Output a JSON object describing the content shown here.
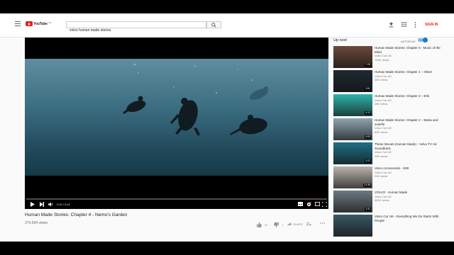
{
  "masthead": {
    "logo_text": "YouTube",
    "logo_region": "GB",
    "search_value": "volvo human made stories",
    "signin_label": "SIGN IN",
    "icons": [
      "menu-icon",
      "search-icon",
      "upload-icon",
      "apps-icon",
      "more-vert-icon"
    ]
  },
  "player": {
    "time_current": "0:00",
    "time_total": "5:41",
    "progress_fraction": 0.0
  },
  "video": {
    "title": "Human Made Stories: Chapter 4 - Nemo's Garden",
    "views": "274,934 views",
    "likes": "42",
    "dislikes": "1",
    "share_label": "SHARE"
  },
  "sidebar": {
    "up_next_label": "Up next",
    "autoplay_label": "AUTOPLAY",
    "autoplay_on": true,
    "items": [
      {
        "title": "Human Made Stories: Chapter 5 - Music of the Mind",
        "channel": "Volvo Car UK",
        "views": "754K views",
        "duration": "7:25",
        "color": "#6b4a3a"
      },
      {
        "title": "Human Made Stories: Chapter 1 – Oliver",
        "channel": "Volvo Car UK",
        "views": "45K views",
        "duration": "3:51",
        "color": "#1e2a33"
      },
      {
        "title": "Human Made Stories: Chapter 3 – Erik",
        "channel": "Volvo Car UK",
        "views": "48K views",
        "duration": "4:12",
        "color": "#2fb3a8"
      },
      {
        "title": "Human Made Stories: Chapter 2 – Maria and Josefin",
        "channel": "Volvo Car UK",
        "views": "60K views",
        "duration": "4:00",
        "color": "#8fa4b0"
      },
      {
        "title": "These Woods (Human Made) - Volvo TV Ad Soundtrack",
        "channel": "Volvo Car UK",
        "views": "16K views",
        "duration": "4:21",
        "color": "#1f6f86"
      },
      {
        "title": "Volvo Accessories - S90",
        "channel": "Volvo Car UK",
        "views": "20K views",
        "duration": "21:36",
        "color": "#b9b3ab"
      },
      {
        "title": "VOLVO - Human Made",
        "channel": "Volvo Car UK",
        "views": "461K views",
        "duration": "1:31",
        "color": "#6c7a82"
      },
      {
        "title": "Volvo Car UK - Everything We Do Starts With People",
        "channel": "",
        "views": "",
        "duration": "",
        "color": "#3a5866"
      }
    ]
  }
}
